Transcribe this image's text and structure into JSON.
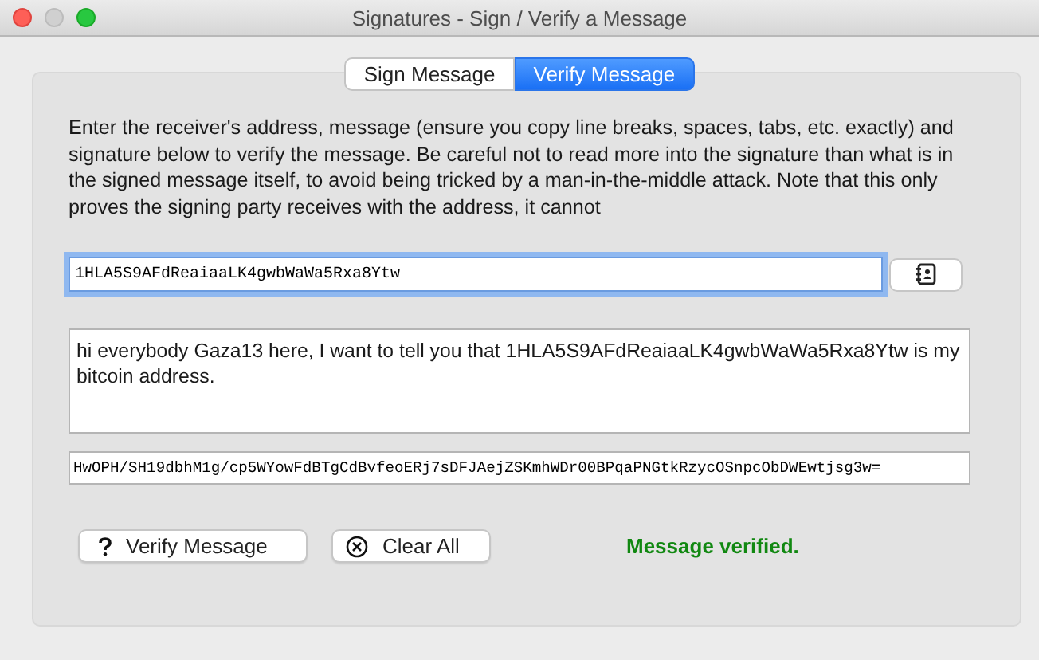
{
  "window": {
    "title": "Signatures - Sign / Verify a Message"
  },
  "tabs": [
    {
      "label": "Sign Message",
      "selected": false
    },
    {
      "label": "Verify Message",
      "selected": true
    }
  ],
  "instructions": "Enter the receiver's address, message (ensure you copy line breaks, spaces, tabs, etc. exactly) and signature below to verify the message. Be careful not to read more into the signature than what is in the signed message itself, to avoid being tricked by a man-in-the-middle attack. Note that this only proves the signing party receives with the address, it cannot",
  "address": {
    "value": "1HLA5S9AFdReaiaaLK4gwbWaWa5Rxa8Ytw",
    "focused": true
  },
  "message": {
    "value": "hi everybody Gaza13 here, I want to tell you that 1HLA5S9AFdReaiaaLK4gwbWaWa5Rxa8Ytw is my bitcoin address."
  },
  "signature": {
    "value": "HwOPH/SH19dbhM1g/cp5WYowFdBTgCdBvfeoERj7sDFJAejZSKmhWDr00BPqaPNGtkRzycOSnpcObDWEwtjsg3w="
  },
  "buttons": [
    {
      "label": "Verify Message",
      "kind": "verify"
    },
    {
      "label": "Clear All",
      "kind": "clear"
    }
  ],
  "status": {
    "text": "Message verified.",
    "color": "#118811"
  }
}
